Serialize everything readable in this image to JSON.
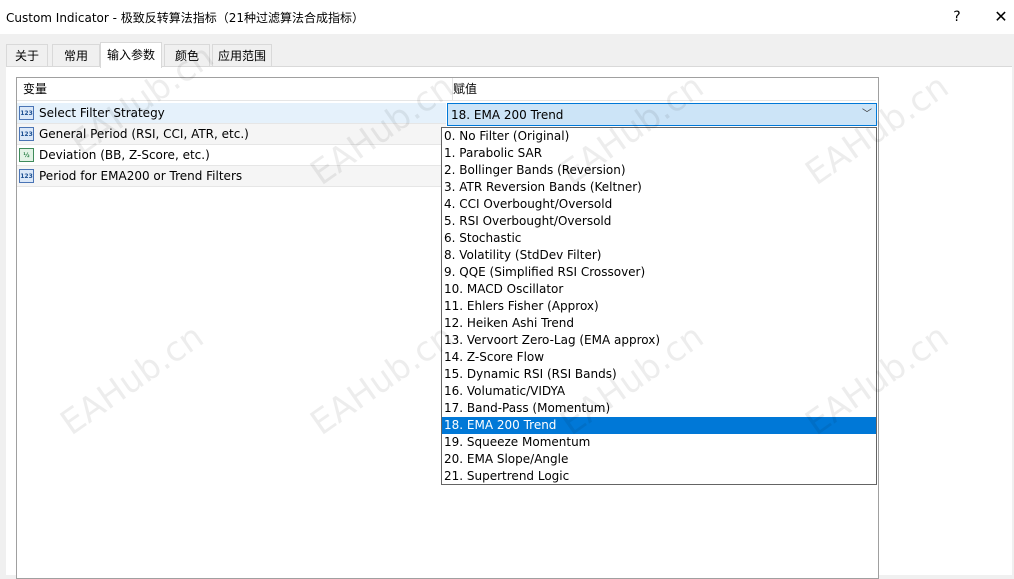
{
  "window": {
    "title": "Custom Indicator - 极致反转算法指标（21种过滤算法合成指标）",
    "help_glyph": "?",
    "close_glyph": "✕"
  },
  "tabs": [
    {
      "label": "关于"
    },
    {
      "label": "常用"
    },
    {
      "label": "输入参数"
    },
    {
      "label": "颜色"
    },
    {
      "label": "应用范围"
    }
  ],
  "active_tab": "输入参数",
  "grid": {
    "col_variable": "变量",
    "col_value": "赋值",
    "rows": [
      {
        "icon": "int-param-icon",
        "icon_text": "123",
        "label": "Select Filter Strategy"
      },
      {
        "icon": "int-param-icon",
        "icon_text": "123",
        "label": "General Period (RSI, CCI, ATR, etc.)"
      },
      {
        "icon": "double-param-icon",
        "icon_text": "½",
        "label": "Deviation (BB, Z-Score, etc.)"
      },
      {
        "icon": "int-param-icon",
        "icon_text": "123",
        "label": "Period for EMA200 or Trend Filters"
      }
    ]
  },
  "combo": {
    "value": "18. EMA 200 Trend",
    "arrow_glyph": "﹀"
  },
  "dropdown_options": [
    "0. No Filter (Original)",
    "1. Parabolic SAR",
    "2. Bollinger Bands (Reversion)",
    "3. ATR Reversion Bands (Keltner)",
    "4. CCI Overbought/Oversold",
    "5. RSI Overbought/Oversold",
    "6. Stochastic",
    "8. Volatility (StdDev Filter)",
    "9. QQE (Simplified RSI Crossover)",
    "10. MACD Oscillator",
    "11. Ehlers Fisher (Approx)",
    "12. Heiken Ashi Trend",
    "13. Vervoort Zero-Lag (EMA approx)",
    "14. Z-Score Flow",
    "15. Dynamic RSI (RSI Bands)",
    "16. Volumatic/VIDYA",
    "17. Band-Pass (Momentum)",
    "18. EMA 200 Trend",
    "19. Squeeze Momentum",
    "20. EMA Slope/Angle",
    "21. Supertrend Logic"
  ],
  "selected_option_index": 17,
  "watermark": "EAHub.cn",
  "colors": {
    "selection": "#0078d7",
    "combo_bg": "#cce4f7",
    "row_selected": "#e5f1fb"
  }
}
